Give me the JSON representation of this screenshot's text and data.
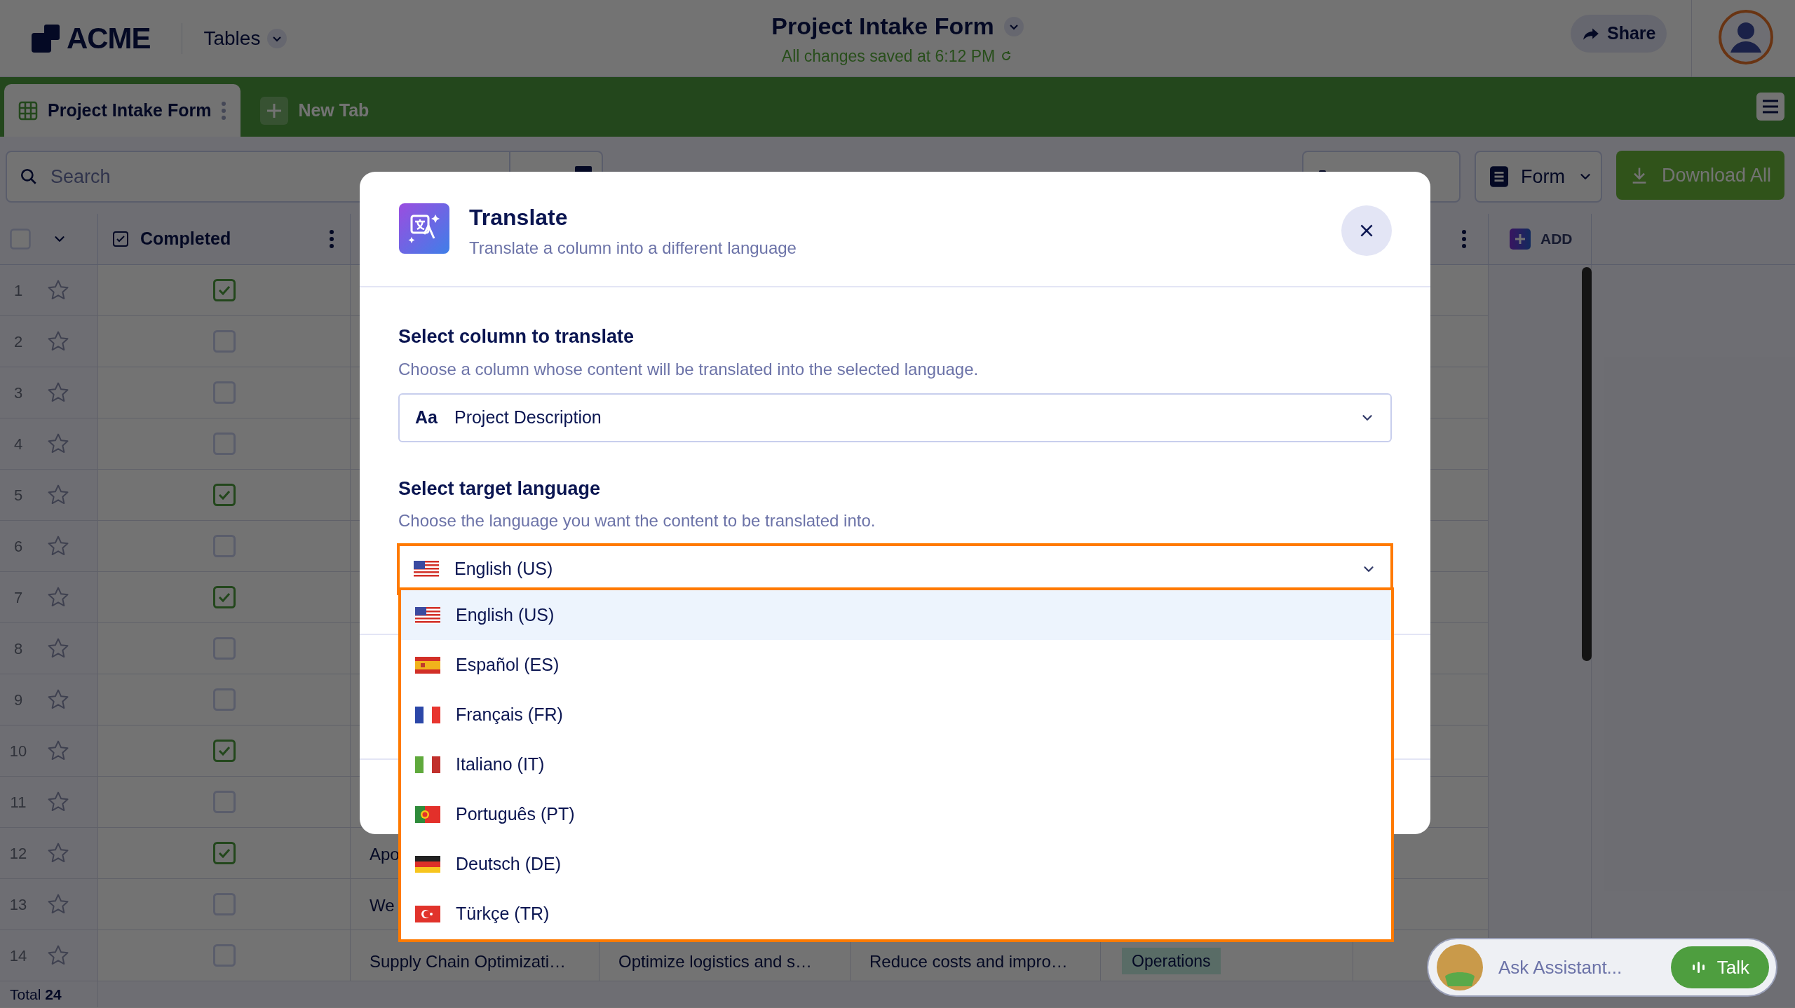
{
  "header": {
    "logo": "ACME",
    "menu": "Tables",
    "title": "Project Intake Form",
    "save_status": "All changes saved at 6:12 PM",
    "share": "Share"
  },
  "tabs": [
    {
      "label": "Project Intake Form",
      "selected": true,
      "kind": "sheet"
    },
    {
      "label": "New Tab",
      "selected": false,
      "kind": "add"
    }
  ],
  "toolbar": {
    "search_placeholder": "Search",
    "view": "Form",
    "download": "Download All"
  },
  "table": {
    "select_all": false,
    "completed_header": "Completed",
    "add_column": "ADD",
    "total": "Total **24**",
    "rows": [
      {
        "number": "1",
        "completed": true
      },
      {
        "number": "2",
        "completed": false
      },
      {
        "number": "3",
        "completed": false
      },
      {
        "number": "4",
        "completed": false
      },
      {
        "number": "5",
        "completed": true
      },
      {
        "number": "6",
        "completed": false
      },
      {
        "number": "7",
        "completed": true
      },
      {
        "number": "8",
        "completed": false
      },
      {
        "number": "9",
        "completed": false
      },
      {
        "number": "10",
        "completed": true
      },
      {
        "number": "11",
        "completed": false
      },
      {
        "number": "12",
        "completed": true,
        "cells": [
          {
            "text": "Apo",
            "kind": "text"
          }
        ]
      },
      {
        "number": "13",
        "completed": false,
        "cells": [
          {
            "text": "We",
            "kind": "text"
          }
        ]
      },
      {
        "number": "14",
        "completed": false,
        "cells": [
          {
            "text": "Supply Chain Optimizati…",
            "kind": "text"
          },
          {
            "text": "Optimize logistics and s…",
            "kind": "text"
          },
          {
            "text": "Reduce costs and impro…",
            "kind": "text"
          },
          {
            "text": "Operations",
            "kind": "tag"
          }
        ]
      }
    ]
  },
  "modal": {
    "title": "Translate",
    "subtitle": "Translate a column into a different language",
    "column_section": {
      "label": "Select column to translate",
      "hint": "Choose a column whose content will be translated into the selected language.",
      "type_icon": "Aa",
      "value": "Project Description"
    },
    "language_section": {
      "label": "Select target language",
      "hint": "Choose the language you want the content to be translated into.",
      "value": "English (US)",
      "kind": "us",
      "open": true
    },
    "options": [
      {
        "label": "English (US)",
        "kind": "us",
        "selected": true
      },
      {
        "label": "Español (ES)",
        "kind": "es",
        "selected": false
      },
      {
        "label": "Français (FR)",
        "kind": "fr",
        "selected": false
      },
      {
        "label": "Italiano (IT)",
        "kind": "it",
        "selected": false
      },
      {
        "label": "Português (PT)",
        "kind": "pt",
        "selected": false
      },
      {
        "label": "Deutsch (DE)",
        "kind": "de",
        "selected": false
      },
      {
        "label": "Türkçe (TR)",
        "kind": "tr",
        "selected": false
      }
    ]
  },
  "assistant": {
    "placeholder": "Ask Assistant...",
    "talk": "Talk"
  }
}
